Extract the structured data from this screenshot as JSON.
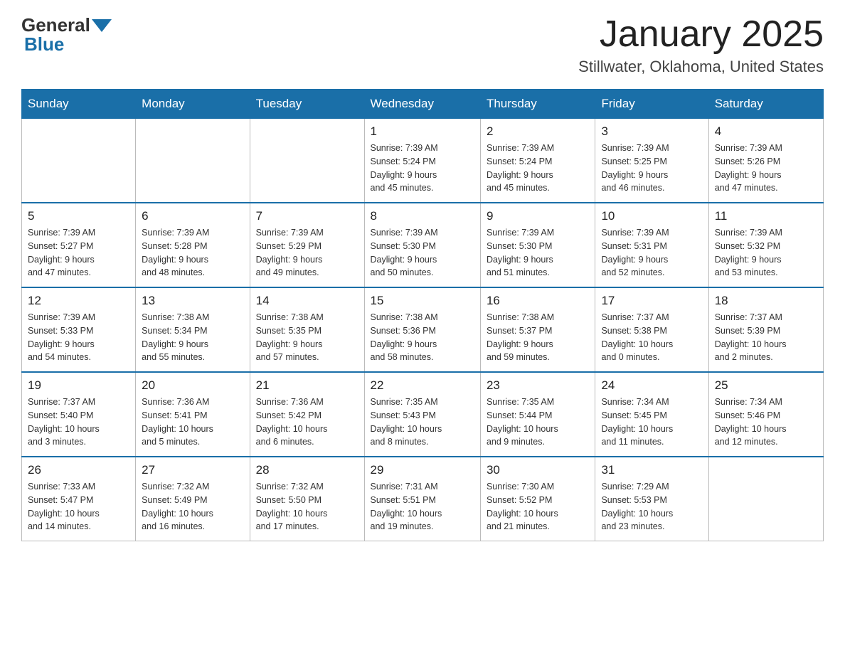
{
  "header": {
    "logo_general": "General",
    "logo_blue": "Blue",
    "month": "January 2025",
    "location": "Stillwater, Oklahoma, United States"
  },
  "days_of_week": [
    "Sunday",
    "Monday",
    "Tuesday",
    "Wednesday",
    "Thursday",
    "Friday",
    "Saturday"
  ],
  "weeks": [
    [
      {
        "day": "",
        "info": ""
      },
      {
        "day": "",
        "info": ""
      },
      {
        "day": "",
        "info": ""
      },
      {
        "day": "1",
        "info": "Sunrise: 7:39 AM\nSunset: 5:24 PM\nDaylight: 9 hours\nand 45 minutes."
      },
      {
        "day": "2",
        "info": "Sunrise: 7:39 AM\nSunset: 5:24 PM\nDaylight: 9 hours\nand 45 minutes."
      },
      {
        "day": "3",
        "info": "Sunrise: 7:39 AM\nSunset: 5:25 PM\nDaylight: 9 hours\nand 46 minutes."
      },
      {
        "day": "4",
        "info": "Sunrise: 7:39 AM\nSunset: 5:26 PM\nDaylight: 9 hours\nand 47 minutes."
      }
    ],
    [
      {
        "day": "5",
        "info": "Sunrise: 7:39 AM\nSunset: 5:27 PM\nDaylight: 9 hours\nand 47 minutes."
      },
      {
        "day": "6",
        "info": "Sunrise: 7:39 AM\nSunset: 5:28 PM\nDaylight: 9 hours\nand 48 minutes."
      },
      {
        "day": "7",
        "info": "Sunrise: 7:39 AM\nSunset: 5:29 PM\nDaylight: 9 hours\nand 49 minutes."
      },
      {
        "day": "8",
        "info": "Sunrise: 7:39 AM\nSunset: 5:30 PM\nDaylight: 9 hours\nand 50 minutes."
      },
      {
        "day": "9",
        "info": "Sunrise: 7:39 AM\nSunset: 5:30 PM\nDaylight: 9 hours\nand 51 minutes."
      },
      {
        "day": "10",
        "info": "Sunrise: 7:39 AM\nSunset: 5:31 PM\nDaylight: 9 hours\nand 52 minutes."
      },
      {
        "day": "11",
        "info": "Sunrise: 7:39 AM\nSunset: 5:32 PM\nDaylight: 9 hours\nand 53 minutes."
      }
    ],
    [
      {
        "day": "12",
        "info": "Sunrise: 7:39 AM\nSunset: 5:33 PM\nDaylight: 9 hours\nand 54 minutes."
      },
      {
        "day": "13",
        "info": "Sunrise: 7:38 AM\nSunset: 5:34 PM\nDaylight: 9 hours\nand 55 minutes."
      },
      {
        "day": "14",
        "info": "Sunrise: 7:38 AM\nSunset: 5:35 PM\nDaylight: 9 hours\nand 57 minutes."
      },
      {
        "day": "15",
        "info": "Sunrise: 7:38 AM\nSunset: 5:36 PM\nDaylight: 9 hours\nand 58 minutes."
      },
      {
        "day": "16",
        "info": "Sunrise: 7:38 AM\nSunset: 5:37 PM\nDaylight: 9 hours\nand 59 minutes."
      },
      {
        "day": "17",
        "info": "Sunrise: 7:37 AM\nSunset: 5:38 PM\nDaylight: 10 hours\nand 0 minutes."
      },
      {
        "day": "18",
        "info": "Sunrise: 7:37 AM\nSunset: 5:39 PM\nDaylight: 10 hours\nand 2 minutes."
      }
    ],
    [
      {
        "day": "19",
        "info": "Sunrise: 7:37 AM\nSunset: 5:40 PM\nDaylight: 10 hours\nand 3 minutes."
      },
      {
        "day": "20",
        "info": "Sunrise: 7:36 AM\nSunset: 5:41 PM\nDaylight: 10 hours\nand 5 minutes."
      },
      {
        "day": "21",
        "info": "Sunrise: 7:36 AM\nSunset: 5:42 PM\nDaylight: 10 hours\nand 6 minutes."
      },
      {
        "day": "22",
        "info": "Sunrise: 7:35 AM\nSunset: 5:43 PM\nDaylight: 10 hours\nand 8 minutes."
      },
      {
        "day": "23",
        "info": "Sunrise: 7:35 AM\nSunset: 5:44 PM\nDaylight: 10 hours\nand 9 minutes."
      },
      {
        "day": "24",
        "info": "Sunrise: 7:34 AM\nSunset: 5:45 PM\nDaylight: 10 hours\nand 11 minutes."
      },
      {
        "day": "25",
        "info": "Sunrise: 7:34 AM\nSunset: 5:46 PM\nDaylight: 10 hours\nand 12 minutes."
      }
    ],
    [
      {
        "day": "26",
        "info": "Sunrise: 7:33 AM\nSunset: 5:47 PM\nDaylight: 10 hours\nand 14 minutes."
      },
      {
        "day": "27",
        "info": "Sunrise: 7:32 AM\nSunset: 5:49 PM\nDaylight: 10 hours\nand 16 minutes."
      },
      {
        "day": "28",
        "info": "Sunrise: 7:32 AM\nSunset: 5:50 PM\nDaylight: 10 hours\nand 17 minutes."
      },
      {
        "day": "29",
        "info": "Sunrise: 7:31 AM\nSunset: 5:51 PM\nDaylight: 10 hours\nand 19 minutes."
      },
      {
        "day": "30",
        "info": "Sunrise: 7:30 AM\nSunset: 5:52 PM\nDaylight: 10 hours\nand 21 minutes."
      },
      {
        "day": "31",
        "info": "Sunrise: 7:29 AM\nSunset: 5:53 PM\nDaylight: 10 hours\nand 23 minutes."
      },
      {
        "day": "",
        "info": ""
      }
    ]
  ]
}
